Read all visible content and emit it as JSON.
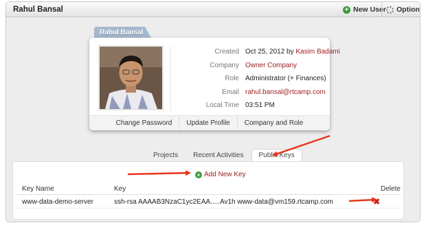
{
  "header": {
    "title": "Rahul Bansal",
    "new_user_label": "New User",
    "options_label": "Options"
  },
  "profile": {
    "name_tag": "Rahul Bansal",
    "fields": [
      {
        "label": "Created",
        "value": "Oct 25, 2012 by",
        "value_link": "Kasim Badami"
      },
      {
        "label": "Company",
        "value_link": "Owner Company"
      },
      {
        "label": "Role",
        "value": "Administrator (+ Finances)"
      },
      {
        "label": "Email",
        "value_link": "rahul.bansal@rtcamp.com"
      },
      {
        "label": "Local Time",
        "value": "03:51 PM"
      }
    ],
    "actions": [
      "Change Password",
      "Update Profile",
      "Company and Role"
    ]
  },
  "tabs": [
    "Projects",
    "Recent Activities",
    "Public Keys"
  ],
  "active_tab": "Public Keys",
  "keys_panel": {
    "add_label": "Add New Key",
    "columns": [
      "Key Name",
      "Key",
      "Delete"
    ],
    "rows": [
      {
        "name": "www-data-demo-server",
        "key": "ssh-rsa AAAAB3NzaC1yc2EAA.....Av1h www-data@vm159.rtcamp.com"
      }
    ]
  },
  "colors": {
    "link": "#9b1c1c",
    "arrow": "#e8321c",
    "add_icon": "#3a9b3a",
    "delete_icon": "#c62121",
    "tag": "#a6b8cd"
  }
}
